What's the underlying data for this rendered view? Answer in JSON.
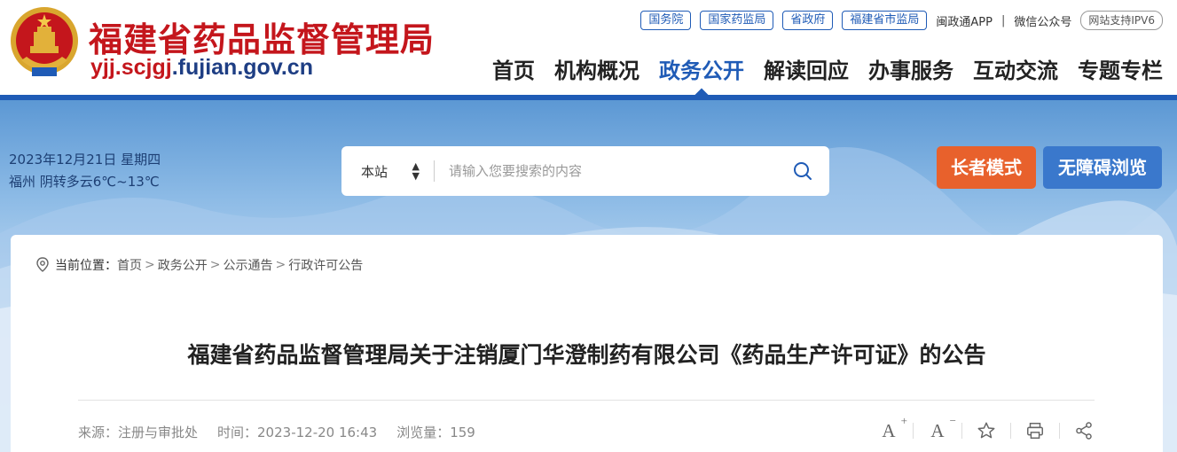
{
  "header": {
    "site_name": "福建省药品监督管理局",
    "domain_prefix": "yjj.scjgj",
    "domain_suffix": ".fujian.gov.cn",
    "top_links": [
      "国务院",
      "国家药监局",
      "省政府",
      "福建省市监局"
    ],
    "app_label": "闽政通APP",
    "wechat_label": "微信公众号",
    "separator": "|",
    "ipv6_label": "网站支持IPV6",
    "nav": [
      {
        "label": "首页"
      },
      {
        "label": "机构概况"
      },
      {
        "label": "政务公开",
        "active": true
      },
      {
        "label": "解读回应"
      },
      {
        "label": "办事服务"
      },
      {
        "label": "互动交流"
      },
      {
        "label": "专题专栏"
      }
    ]
  },
  "info": {
    "date_line": "2023年12月21日 星期四",
    "weather_line": "福州 阴转多云6℃~13℃"
  },
  "search": {
    "scope": "本站",
    "placeholder": "请输入您要搜索的内容"
  },
  "buttons": {
    "elder": "长者模式",
    "accessible": "无障碍浏览"
  },
  "breadcrumb": {
    "prefix": "当前位置：",
    "items": [
      "首页",
      "政务公开",
      "公示通告",
      "行政许可公告"
    ],
    "separator": ">"
  },
  "article": {
    "title": "福建省药品监督管理局关于注销厦门华澄制药有限公司《药品生产许可证》的公告",
    "source": "来源：注册与审批处",
    "time": "时间：2023-12-20 16:43",
    "views": "浏览量：159"
  },
  "tools": {
    "font_up": "A",
    "font_up_sign": "+",
    "font_down": "A",
    "font_down_sign": "−"
  },
  "colors": {
    "brand_red": "#c4161c",
    "brand_blue": "#1f5bb6",
    "elder_orange": "#e8612c",
    "access_blue": "#3a78cc"
  }
}
